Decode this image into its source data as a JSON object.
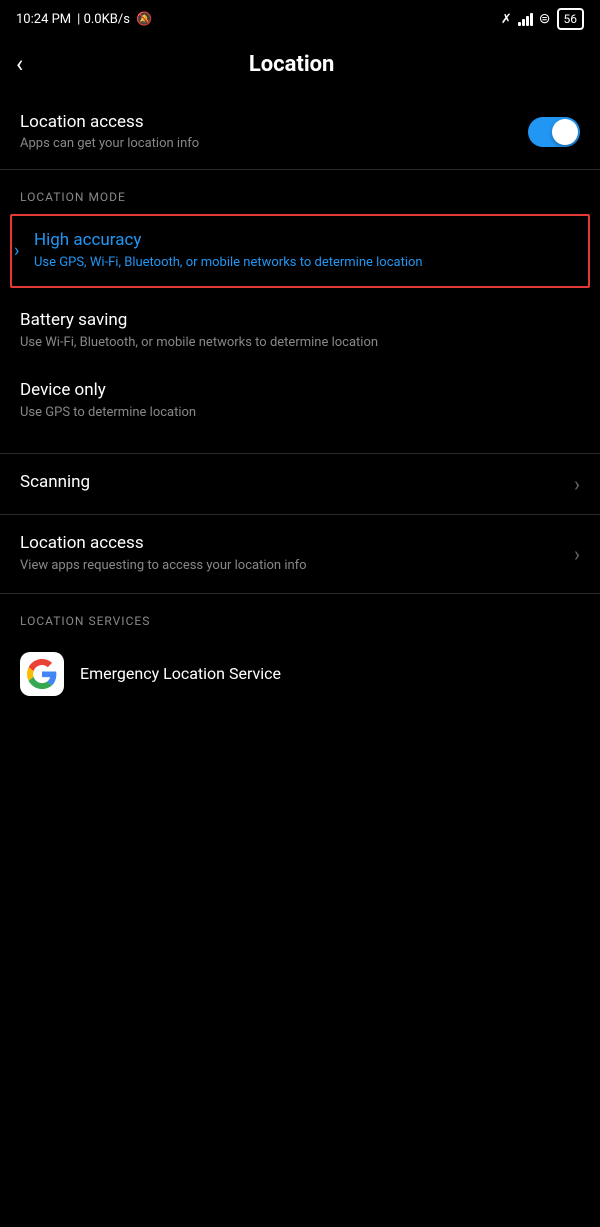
{
  "status_bar": {
    "time": "10:24 PM",
    "data_speed": "0.0KB/s",
    "battery_level": "56"
  },
  "header": {
    "back_label": "‹",
    "title": "Location"
  },
  "location_access": {
    "label": "Location access",
    "description": "Apps can get your location info",
    "toggle_state": true
  },
  "location_mode": {
    "section_header": "LOCATION MODE",
    "modes": [
      {
        "title": "High accuracy",
        "description": "Use GPS, Wi-Fi, Bluetooth, or mobile networks to determine location",
        "highlighted": true,
        "selected": true
      },
      {
        "title": "Battery saving",
        "description": "Use Wi-Fi, Bluetooth, or mobile networks to determine location",
        "highlighted": false,
        "selected": false
      },
      {
        "title": "Device only",
        "description": "Use GPS to determine location",
        "highlighted": false,
        "selected": false
      }
    ]
  },
  "menu_items": [
    {
      "title": "Scanning",
      "description": "",
      "has_chevron": true
    },
    {
      "title": "Location access",
      "description": "View apps requesting to access your location info",
      "has_chevron": true
    }
  ],
  "location_services": {
    "section_header": "LOCATION SERVICES",
    "items": [
      {
        "icon": "google",
        "name": "Emergency Location Service"
      }
    ]
  }
}
